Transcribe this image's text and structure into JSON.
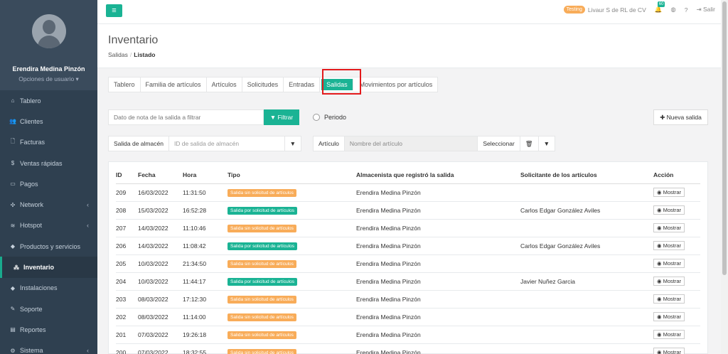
{
  "user": {
    "name": "Erendira Medina Pinzón",
    "options": "Opciones de usuario ▾"
  },
  "nav": [
    {
      "label": "Tablero",
      "icon": "⌂",
      "chev": ""
    },
    {
      "label": "Clientes",
      "icon": "👥",
      "chev": ""
    },
    {
      "label": "Facturas",
      "icon": "🗋",
      "chev": ""
    },
    {
      "label": "Ventas rápidas",
      "icon": "$",
      "chev": ""
    },
    {
      "label": "Pagos",
      "icon": "▭",
      "chev": ""
    },
    {
      "label": "Network",
      "icon": "✣",
      "chev": "‹"
    },
    {
      "label": "Hotspot",
      "icon": "≋",
      "chev": "‹"
    },
    {
      "label": "Productos y servicios",
      "icon": "◆",
      "chev": ""
    },
    {
      "label": "Inventario",
      "icon": "⁂",
      "chev": ""
    },
    {
      "label": "Instalaciones",
      "icon": "◆",
      "chev": ""
    },
    {
      "label": "Soporte",
      "icon": "✎",
      "chev": ""
    },
    {
      "label": "Reportes",
      "icon": "▤",
      "chev": ""
    },
    {
      "label": "Sistema",
      "icon": "⚙",
      "chev": "‹"
    }
  ],
  "topbar": {
    "menu_icon": "≡",
    "testing": "Testing",
    "company": "Livaur S de RL de CV",
    "badge": "60",
    "bell": "🔔",
    "globe": "◍",
    "help": "?",
    "logout": "⇥ Salir"
  },
  "header": {
    "title": "Inventario",
    "crumb_1": "Salidas",
    "crumb_sep": "/",
    "crumb_2": "Listado"
  },
  "tabs": [
    "Tablero",
    "Familia de artículos",
    "Artículos",
    "Solicitudes",
    "Entradas",
    "Salidas",
    "Movimientos por artículos"
  ],
  "filters": {
    "nota_placeholder": "Dato de nota de la salida a filtrar",
    "filtrar": "▼ Filtrar",
    "periodo": "Periodo",
    "nueva": "✚ Nueva salida",
    "salida_label": "Salida de almacén",
    "salida_placeholder": "ID de salida de almacén",
    "funnel": "▼",
    "articulo_label": "Artículo",
    "articulo_placeholder": "Nombre del artículo",
    "seleccionar": "Seleccionar",
    "trash": "🗑"
  },
  "table": {
    "headers": [
      "ID",
      "Fecha",
      "Hora",
      "Tipo",
      "Almacenista que registró la salida",
      "Solicitante de los artículos",
      "Acción"
    ],
    "action_label": "◉ Mostrar",
    "rows": [
      {
        "id": "209",
        "fecha": "16/03/2022",
        "hora": "11:31:50",
        "tipo": "Salida sin solicitud de artículos",
        "kind": "sin",
        "almacenista": "Erendira Medina Pinzón",
        "solicitante": ""
      },
      {
        "id": "208",
        "fecha": "15/03/2022",
        "hora": "16:52:28",
        "tipo": "Salida por solicitud de artículos",
        "kind": "por",
        "almacenista": "Erendira Medina Pinzón",
        "solicitante": "Carlos Edgar González Aviles"
      },
      {
        "id": "207",
        "fecha": "14/03/2022",
        "hora": "11:10:46",
        "tipo": "Salida sin solicitud de artículos",
        "kind": "sin",
        "almacenista": "Erendira Medina Pinzón",
        "solicitante": ""
      },
      {
        "id": "206",
        "fecha": "14/03/2022",
        "hora": "11:08:42",
        "tipo": "Salida por solicitud de artículos",
        "kind": "por",
        "almacenista": "Erendira Medina Pinzón",
        "solicitante": "Carlos Edgar González Aviles"
      },
      {
        "id": "205",
        "fecha": "10/03/2022",
        "hora": "21:34:50",
        "tipo": "Salida sin solicitud de artículos",
        "kind": "sin",
        "almacenista": "Erendira Medina Pinzón",
        "solicitante": ""
      },
      {
        "id": "204",
        "fecha": "10/03/2022",
        "hora": "11:44:17",
        "tipo": "Salida por solicitud de artículos",
        "kind": "por",
        "almacenista": "Erendira Medina Pinzón",
        "solicitante": "Javier Nuñez Garcia"
      },
      {
        "id": "203",
        "fecha": "08/03/2022",
        "hora": "17:12:30",
        "tipo": "Salida sin solicitud de artículos",
        "kind": "sin",
        "almacenista": "Erendira Medina Pinzón",
        "solicitante": ""
      },
      {
        "id": "202",
        "fecha": "08/03/2022",
        "hora": "11:14:00",
        "tipo": "Salida sin solicitud de artículos",
        "kind": "sin",
        "almacenista": "Erendira Medina Pinzón",
        "solicitante": ""
      },
      {
        "id": "201",
        "fecha": "07/03/2022",
        "hora": "19:26:18",
        "tipo": "Salida sin solicitud de artículos",
        "kind": "sin",
        "almacenista": "Erendira Medina Pinzón",
        "solicitante": ""
      },
      {
        "id": "200",
        "fecha": "07/03/2022",
        "hora": "18:32:55",
        "tipo": "Salida sin solicitud de artículos",
        "kind": "sin",
        "almacenista": "Erendira Medina Pinzón",
        "solicitante": ""
      }
    ]
  }
}
